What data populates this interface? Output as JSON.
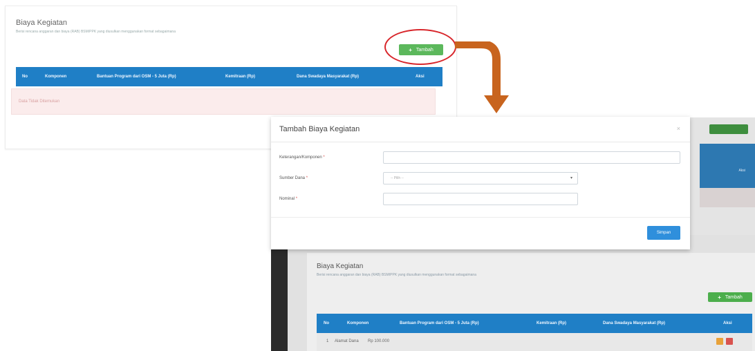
{
  "top_panel": {
    "title": "Biaya Kegiatan",
    "subtitle": "Berisi rencana anggaran dan biaya (RAB) BSM/PPK yang diusulkan menggunakan format sebagaimana",
    "add_button_label": "Tambah",
    "table_headers": [
      "No",
      "Komponen",
      "Bantuan Program dari OSM - 5 Juta (Rp)",
      "Kemitraan (Rp)",
      "Dana Swadaya Masyarakat (Rp)",
      "Aksi"
    ],
    "empty_message": "Data Tidak Ditemukan"
  },
  "modal": {
    "title": "Tambah Biaya Kegiatan",
    "close_symbol": "×",
    "fields": [
      {
        "label": "Keterangan/Komponen",
        "required_mark": "*",
        "type": "text",
        "value": ""
      },
      {
        "label": "Sumber Dana",
        "required_mark": "*",
        "type": "select",
        "value": "-- Pilih --"
      },
      {
        "label": "Nominal",
        "required_mark": "*",
        "type": "text",
        "value": ""
      }
    ],
    "submit_label": "Simpan"
  },
  "bottom_panel": {
    "title": "Biaya Kegiatan",
    "subtitle": "Berisi rencana anggaran dan biaya (RAB) BSM/PPK yang diusulkan menggunakan format sebagaimana",
    "add_button_label": "Tambah",
    "table_headers": [
      "No",
      "Komponen",
      "Bantuan Program dari OSM - 5 Juta (Rp)",
      "Kemitraan (Rp)",
      "Dana Swadaya Masyarakat (Rp)",
      "Aksi"
    ],
    "row": {
      "no": "1",
      "komponen": "Alamat Dana",
      "nominal": "Rp 100.000"
    }
  },
  "colors": {
    "table_header": "#1f7fc6",
    "add_button": "#5cb85c",
    "submit_button": "#2f8fdc",
    "highlight": "#d8262b",
    "arrow": "#c8641e",
    "edit_action": "#e8a23a",
    "delete_action": "#d9534f"
  },
  "icons": [
    "plus-icon",
    "close-icon",
    "chevron-down-icon",
    "edit-icon",
    "delete-icon",
    "arrow-down-right-icon"
  ]
}
